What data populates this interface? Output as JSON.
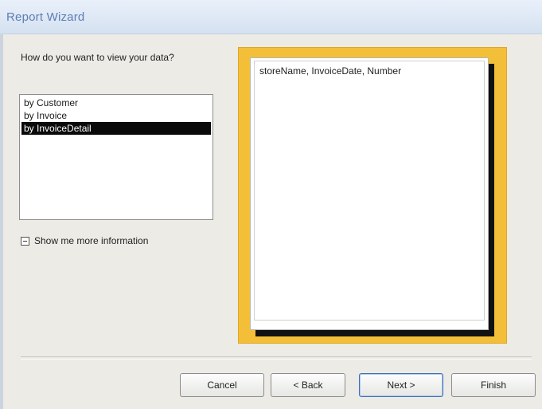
{
  "window": {
    "title": "Report Wizard"
  },
  "left_panel": {
    "question": "How do you want to view your data?",
    "view_options": [
      {
        "label": "by Customer",
        "selected": false
      },
      {
        "label": "by Invoice",
        "selected": false
      },
      {
        "label": "by InvoiceDetail",
        "selected": true
      }
    ],
    "more_info_label": "Show me more information"
  },
  "preview": {
    "fields": "storeName, InvoiceDate, Number"
  },
  "buttons": {
    "cancel": "Cancel",
    "back": "< Back",
    "next": "Next >",
    "finish": "Finish"
  }
}
